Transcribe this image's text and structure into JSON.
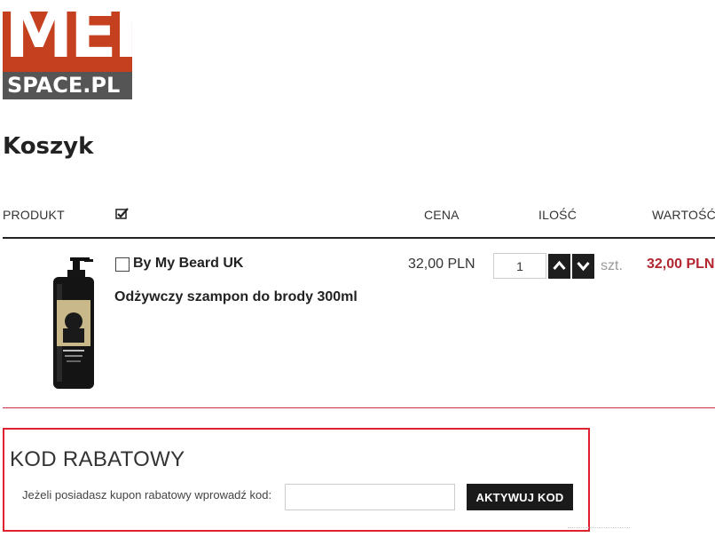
{
  "logo": {
    "top_text": "MEN",
    "bottom_text": "SPACE.PL",
    "brand_color": "#c4401e",
    "bar_color": "#555555"
  },
  "page": {
    "title": "Koszyk"
  },
  "table": {
    "headers": {
      "product": "PRODUKT",
      "check_icon": "checkmark-icon",
      "price": "CENA",
      "quantity": "ILOŚĆ",
      "value": "WARTOŚĆ"
    },
    "rows": [
      {
        "brand": "By My Beard UK",
        "name": "Odżywczy szampon do brody 300ml",
        "price": "32,00 PLN",
        "quantity": "1",
        "unit": "szt.",
        "total": "32,00 PLN",
        "checked": false
      }
    ]
  },
  "coupon": {
    "title": "KOD RABATOWY",
    "label": "Jeżeli posiadasz kupon rabatowy wprowadź kod:",
    "input_value": "",
    "button": "AKTYWUJ KOD"
  },
  "colors": {
    "accent": "#b3252f",
    "highlight_border": "#e02230",
    "button_bg": "#1a1a1a"
  }
}
